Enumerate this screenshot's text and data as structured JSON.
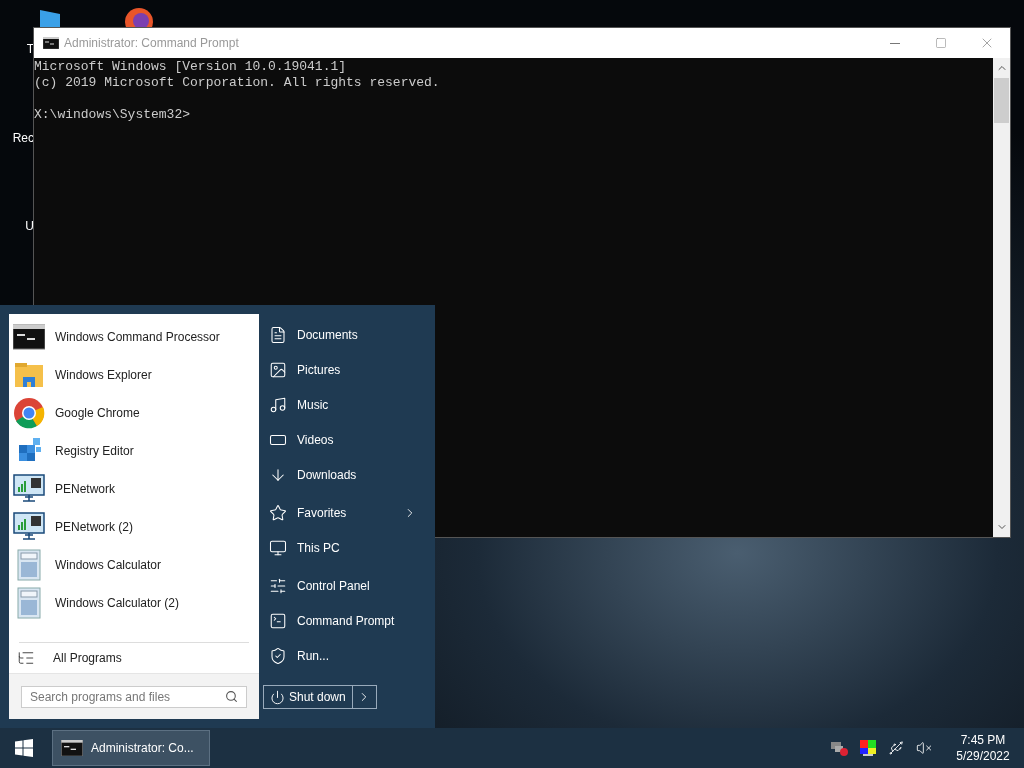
{
  "desktop": {
    "icons": [
      {
        "label": "T"
      },
      {
        "label": "Rec"
      },
      {
        "label": "U"
      }
    ]
  },
  "console_window": {
    "title": "Administrator: Command Prompt",
    "header_lines": [
      "Microsoft Windows [Version 10.0.19041.1]",
      "(c) 2019 Microsoft Corporation. All rights reserved."
    ],
    "prompt": "X:\\windows\\System32>"
  },
  "start_menu": {
    "programs": [
      {
        "name": "Windows Command Processor",
        "kind": "console"
      },
      {
        "name": "Windows Explorer",
        "kind": "folder"
      },
      {
        "name": "Google Chrome",
        "kind": "browser"
      },
      {
        "name": "Registry Editor",
        "kind": "cubes"
      },
      {
        "name": "PENetwork",
        "kind": "network"
      },
      {
        "name": "PENetwork (2)",
        "kind": "network"
      },
      {
        "name": "Windows Calculator",
        "kind": "calculator"
      },
      {
        "name": "Windows Calculator (2)",
        "kind": "calculator"
      }
    ],
    "all_programs": "All Programs",
    "search": {
      "placeholder": "Search programs and files"
    },
    "place_groups": [
      [
        {
          "label": "Documents",
          "kind": "document",
          "submenu": false
        },
        {
          "label": "Pictures",
          "kind": "image",
          "submenu": false
        },
        {
          "label": "Music",
          "kind": "music",
          "submenu": false
        },
        {
          "label": "Videos",
          "kind": "film",
          "submenu": false
        },
        {
          "label": "Downloads",
          "kind": "download",
          "submenu": false
        }
      ],
      [
        {
          "label": "Favorites",
          "kind": "star",
          "submenu": true
        },
        {
          "label": "This PC",
          "kind": "monitor",
          "submenu": false
        }
      ],
      [
        {
          "label": "Control Panel",
          "kind": "panel",
          "submenu": false
        },
        {
          "label": "Command Prompt",
          "kind": "terminal",
          "submenu": false
        },
        {
          "label": "Run...",
          "kind": "run",
          "submenu": false
        }
      ]
    ],
    "shutdown": "Shut down"
  },
  "taskbar": {
    "task": "Administrator: Co...",
    "time": "7:45 PM",
    "date": "5/29/2022"
  }
}
